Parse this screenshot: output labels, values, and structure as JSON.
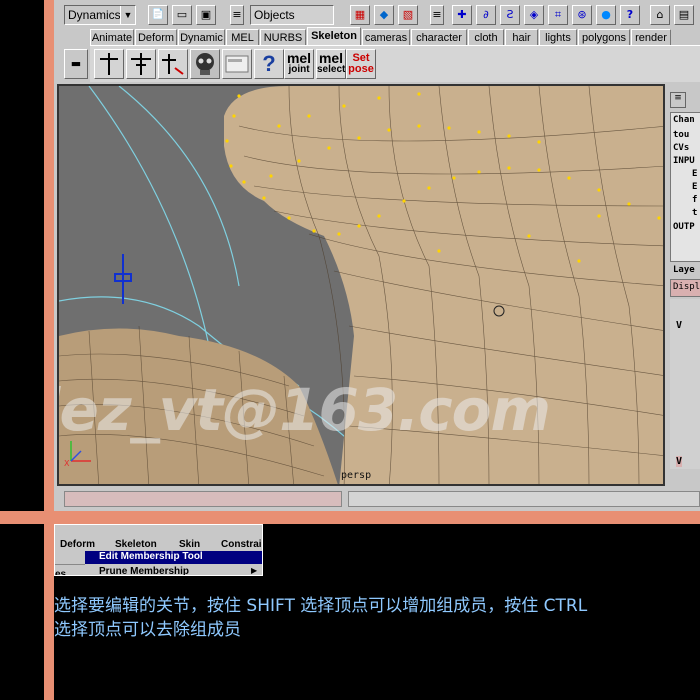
{
  "toolbar": {
    "menu_mode": "Dynamics",
    "selection_mode": "Objects"
  },
  "shelf_tabs": [
    "Animate",
    "Deform",
    "Dynamic",
    "MEL",
    "NURBS",
    "Skeleton",
    "cameras",
    "character",
    "cloth",
    "hair",
    "lights",
    "polygons",
    "render"
  ],
  "shelf_active": "Skeleton",
  "shelf_buttons": {
    "mel_joint_top": "mel",
    "mel_joint_bottom": "joint",
    "mel_select_top": "mel",
    "mel_select_bottom": "select",
    "set_pose_top": "Set",
    "set_pose_bottom": "pose",
    "help": "?"
  },
  "viewport": {
    "camera_label": "persp",
    "watermark": "dez_vt@163.com"
  },
  "channel_box": {
    "title": "Chan",
    "object": "tou",
    "cvs": "CVs",
    "inputs": "INPU",
    "outputs": "OUTP",
    "rows": [
      "E",
      "E",
      "f",
      "t"
    ],
    "layer_title": "Laye",
    "display_tab": "Displ",
    "layer_flag": "V",
    "layer_flag2": "V"
  },
  "menu_snippet": {
    "bar": [
      "Deform",
      "Skeleton",
      "Skin",
      "Constrai"
    ],
    "items": [
      "Edit Membership Tool",
      "Prune Membership"
    ],
    "left_cut": "es"
  },
  "caption": {
    "line1": "选择要编辑的关节，按住 SHIFT 选择顶点可以增加组成员，按住 CTRL",
    "line2": "选择顶点可以去除组成员"
  },
  "colors": {
    "frame": "#e88f73",
    "caption": "#8fc9ff",
    "highlight": "#000080",
    "skin": "#c9b08e"
  }
}
